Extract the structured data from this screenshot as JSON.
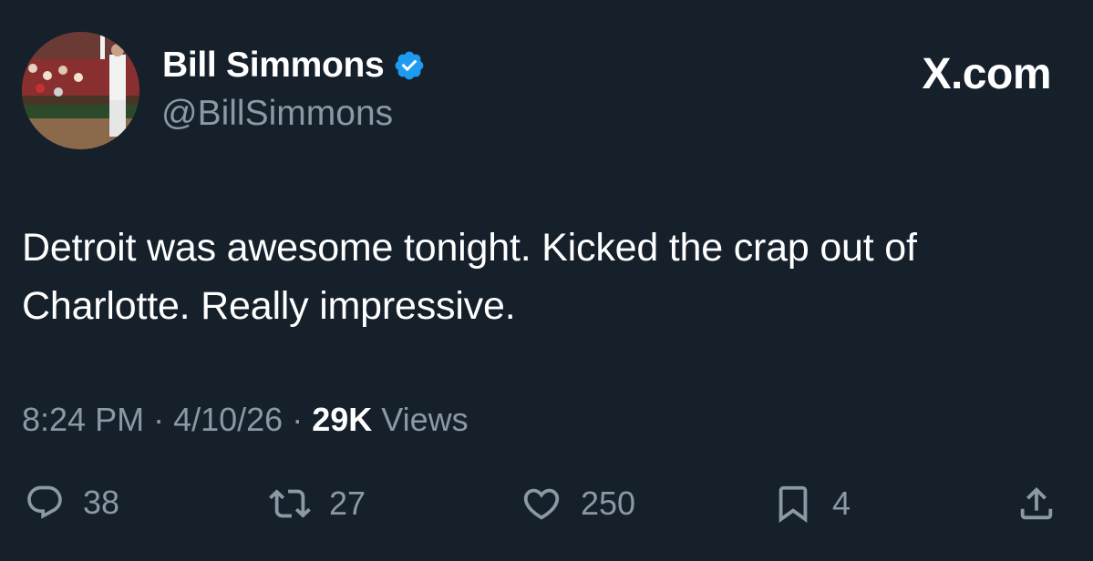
{
  "author": {
    "display_name": "Bill Simmons",
    "handle": "@BillSimmons",
    "verified": true,
    "verified_color": "#1d9bf0"
  },
  "brand": "X.com",
  "tweet": {
    "text": "Detroit was awesome tonight. Kicked the crap out of Charlotte. Really impressive.",
    "time": "8:24 PM",
    "separator": "·",
    "date": "4/10/26",
    "views_count": "29K",
    "views_label": "Views"
  },
  "actions": {
    "reply": {
      "icon": "reply-icon",
      "count": "38"
    },
    "retweet": {
      "icon": "retweet-icon",
      "count": "27"
    },
    "like": {
      "icon": "heart-icon",
      "count": "250"
    },
    "bookmark": {
      "icon": "bookmark-icon",
      "count": "4"
    },
    "share": {
      "icon": "share-icon"
    }
  },
  "colors": {
    "background": "#15202b",
    "secondary_text": "#8b98a5",
    "primary_text": "#ffffff"
  }
}
